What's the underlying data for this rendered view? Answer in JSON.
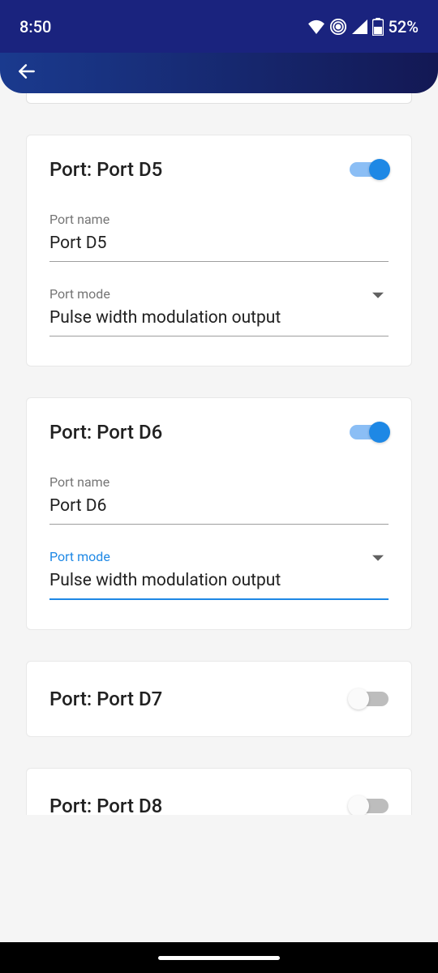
{
  "statusBar": {
    "time": "8:50",
    "battery": "52%"
  },
  "cards": [
    {
      "title": "Port: Port D5",
      "enabled": true,
      "fields": {
        "portName": {
          "label": "Port name",
          "value": "Port D5",
          "active": false
        },
        "portMode": {
          "label": "Port mode",
          "value": "Pulse width modulation output",
          "active": false
        }
      }
    },
    {
      "title": "Port: Port D6",
      "enabled": true,
      "fields": {
        "portName": {
          "label": "Port name",
          "value": "Port D6",
          "active": false
        },
        "portMode": {
          "label": "Port mode",
          "value": "Pulse width modulation output",
          "active": true
        }
      }
    },
    {
      "title": "Port: Port D7",
      "enabled": false
    },
    {
      "title": "Port: Port D8",
      "enabled": false
    }
  ]
}
